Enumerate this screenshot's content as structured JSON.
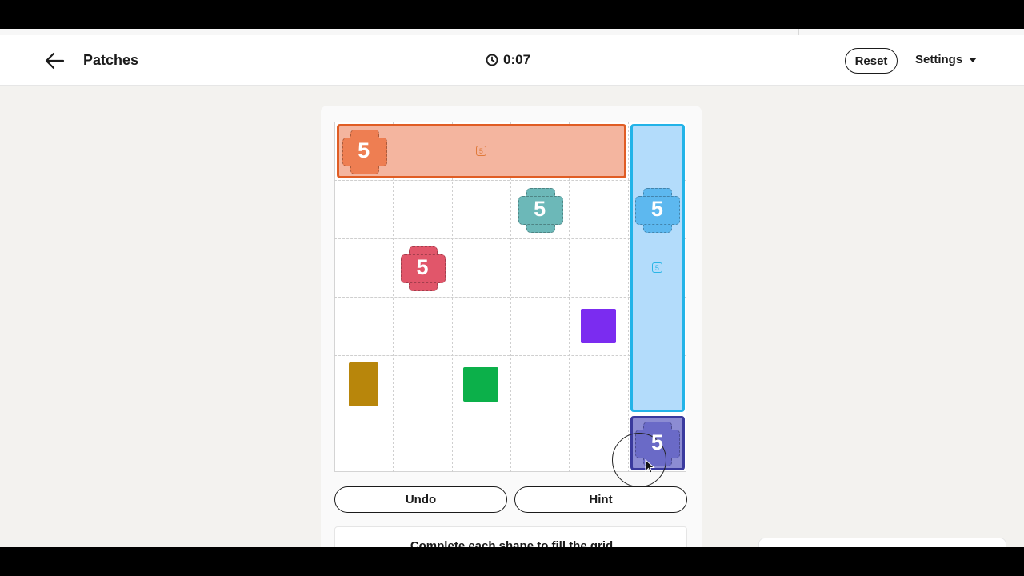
{
  "header": {
    "title": "Patches",
    "timer": "0:07",
    "reset_label": "Reset",
    "settings_label": "Settings"
  },
  "board": {
    "rows": 6,
    "cols": 6,
    "regions": [
      {
        "name": "orange",
        "row": 0,
        "col": 0,
        "width_cells": 5,
        "height_cells": 1,
        "fill": "#f4b59f",
        "border": "#e05d24"
      },
      {
        "name": "blue",
        "row": 0,
        "col": 5,
        "width_cells": 1,
        "height_cells": 5,
        "fill": "#b3dcfb",
        "border": "#22b3e8"
      },
      {
        "name": "indigo",
        "row": 5,
        "col": 5,
        "width_cells": 1,
        "height_cells": 1,
        "fill": "#8c8cd3",
        "border": "#3a3a9e"
      }
    ],
    "clues": [
      {
        "value": "5",
        "row": 0,
        "col": 0,
        "color": "#ee7e52"
      },
      {
        "value": "5",
        "row": 1,
        "col": 3,
        "color": "#6cb8b8"
      },
      {
        "value": "5",
        "row": 1,
        "col": 5,
        "color": "#5db8ef"
      },
      {
        "value": "5",
        "row": 2,
        "col": 1,
        "color": "#e1566a"
      },
      {
        "value": "5",
        "row": 5,
        "col": 5,
        "color": "#6a6ac7"
      }
    ],
    "mini_clues": [
      {
        "value": "5",
        "row": 0,
        "col": 2,
        "color": "#e07a3a"
      },
      {
        "value": "5",
        "row": 2,
        "col": 5,
        "color": "#2ab5e6"
      }
    ],
    "shapes": [
      {
        "name": "purple-square",
        "row": 3,
        "col": 4,
        "w": 0.6,
        "h": 0.6,
        "color": "#7b2cf0"
      },
      {
        "name": "mustard-rectangle",
        "row": 4,
        "col": 0,
        "w": 0.5,
        "h": 0.74,
        "color": "#b8860b"
      },
      {
        "name": "green-square",
        "row": 4,
        "col": 2,
        "w": 0.6,
        "h": 0.6,
        "color": "#0cb04a"
      }
    ]
  },
  "controls": {
    "undo_label": "Undo",
    "hint_label": "Hint"
  },
  "instructions": "Complete each shape to fill the grid"
}
